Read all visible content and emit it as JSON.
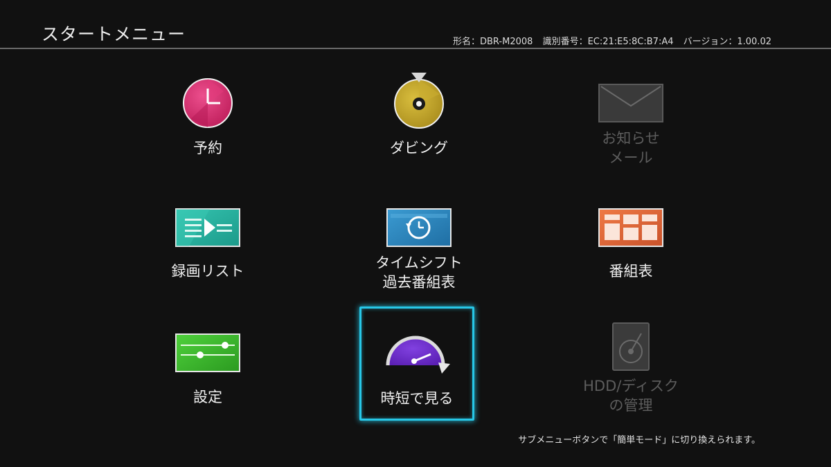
{
  "header": {
    "title": "スタートメニュー",
    "model": "形名：DBR-M2008",
    "id_number": "識別番号：EC:21:E5:8C:B7:A4",
    "version": "バージョン：1.00.02"
  },
  "menu": {
    "reservation": {
      "label": "予約",
      "icon": "clock-icon"
    },
    "dubbing": {
      "label": "ダビング",
      "icon": "disc-icon"
    },
    "notice_mail": {
      "line1": "お知らせ",
      "line2": "メール",
      "icon": "mail-icon",
      "state": "disabled"
    },
    "recording_list": {
      "label": "録画リスト",
      "icon": "play-list-icon"
    },
    "timeshift": {
      "line1": "タイムシフト",
      "line2": "過去番組表",
      "icon": "timeshift-icon"
    },
    "program_guide": {
      "label": "番組表",
      "icon": "grid-icon"
    },
    "settings": {
      "label": "設定",
      "icon": "slider-icon"
    },
    "quick_view": {
      "label": "時短で見る",
      "icon": "speedometer-icon",
      "state": "selected"
    },
    "hdd_disk": {
      "line1": "HDD/ディスク",
      "line2": "の管理",
      "icon": "hdd-icon",
      "state": "disabled"
    }
  },
  "footer": {
    "hint": "サブメニューボタンで「簡単モード」に切り換えられます。"
  },
  "colors": {
    "background": "#111111",
    "selection": "#27c7e7",
    "reservation": "#d82a6e",
    "dubbing": "#c8a92c",
    "recording_list": "#27b3a0",
    "timeshift": "#2c86bf",
    "program_guide": "#e46a3a",
    "settings": "#3fbf2f",
    "quick_view": "#6a2dc8",
    "disabled": "#4a4a4a"
  }
}
